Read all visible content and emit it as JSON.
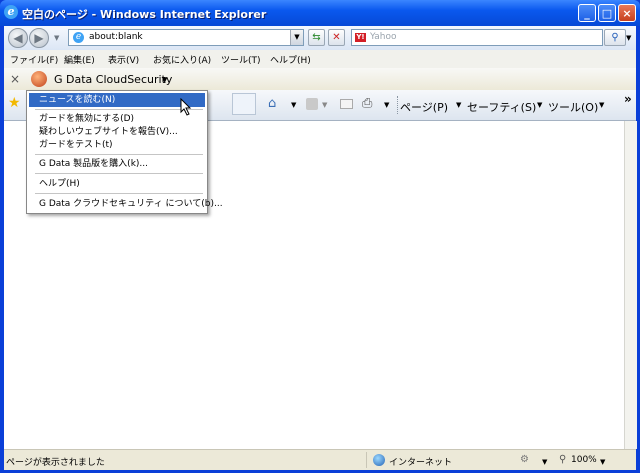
{
  "window": {
    "title": "空白のページ - Windows Internet Explorer"
  },
  "nav": {
    "address": "about:blank",
    "search_placeholder": "Yahoo"
  },
  "menubar": [
    {
      "label": "ファイル(F)"
    },
    {
      "label": "編集(E)"
    },
    {
      "label": "表示(V)"
    },
    {
      "label": "お気に入り(A)"
    },
    {
      "label": "ツール(T)"
    },
    {
      "label": "ヘルプ(H)"
    }
  ],
  "gdata": {
    "close": "×",
    "label": "G Data CloudSecurity"
  },
  "commandbar": {
    "page": "ページ(P)",
    "safety": "セーフティ(S)",
    "tools": "ツール(O)",
    "more": "»"
  },
  "context_menu": {
    "items": [
      "ニュースを読む(N)",
      "ガードを無効にする(D)",
      "疑わしいウェブサイトを報告(V)...",
      "ガードをテスト(t)",
      "G Data 製品版を購入(k)...",
      "ヘルプ(H)",
      "G Data クラウドセキュリティ について(b)..."
    ]
  },
  "status": {
    "text": "ページが表示されました",
    "zone": "インターネット",
    "zoom": "100%"
  },
  "colors": {
    "titlebar": "#0a58ee",
    "menu_highlight": "#316ac5"
  }
}
